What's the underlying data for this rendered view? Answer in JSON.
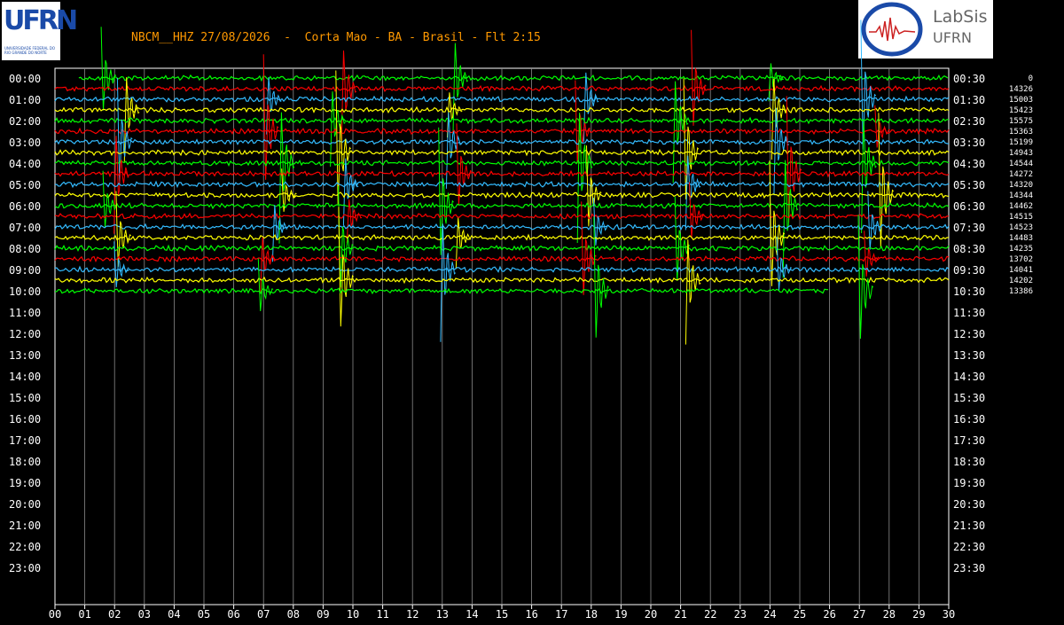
{
  "header": {
    "title": "NBCM__HHZ 27/08/2026  -  Corta Mao - BA - Brasil - Flt 2:15",
    "logo_left_text": "UFRN",
    "logo_left_tagline": "UNIVERSIDADE FEDERAL DO RIO GRANDE DO NORTE",
    "logo_right_line1": "LabSis",
    "logo_right_line2": "UFRN"
  },
  "chart_data": {
    "type": "line",
    "title": "NBCM__HHZ 27/08/2026  -  Corta Mao - BA - Brasil - Flt 2:15",
    "xlabel": "",
    "ylabel": "",
    "x_ticks": [
      "00",
      "01",
      "02",
      "03",
      "04",
      "05",
      "06",
      "07",
      "08",
      "09",
      "10",
      "11",
      "12",
      "13",
      "14",
      "15",
      "16",
      "17",
      "18",
      "19",
      "20",
      "21",
      "22",
      "23",
      "24",
      "25",
      "26",
      "27",
      "28",
      "29",
      "30"
    ],
    "x_range_minutes": [
      0,
      30
    ],
    "hour_labels_left": [
      "00:00",
      "01:00",
      "02:00",
      "03:00",
      "04:00",
      "05:00",
      "06:00",
      "07:00",
      "08:00",
      "09:00",
      "10:00",
      "11:00",
      "12:00",
      "13:00",
      "14:00",
      "15:00",
      "16:00",
      "17:00",
      "18:00",
      "19:00",
      "20:00",
      "21:00",
      "22:00",
      "23:00"
    ],
    "hour_labels_right": [
      "00:30",
      "01:30",
      "02:30",
      "03:30",
      "04:30",
      "05:30",
      "06:30",
      "07:30",
      "08:30",
      "09:30",
      "10:30",
      "11:30",
      "12:30",
      "13:30",
      "14:30",
      "15:30",
      "16:30",
      "17:30",
      "18:30",
      "19:30",
      "20:30",
      "21:30",
      "22:30",
      "23:30"
    ],
    "trace_amplitudes": [
      "0",
      "14326",
      "15003",
      "15423",
      "15575",
      "15363",
      "15199",
      "14943",
      "14544",
      "14272",
      "14320",
      "14344",
      "14462",
      "14515",
      "14523",
      "14483",
      "14235",
      "13702",
      "14041",
      "14202",
      "13386"
    ],
    "trace_colors": [
      "#00ff00",
      "#ff0000",
      "#33bbff",
      "#ffff00"
    ],
    "traces": [
      {
        "color_index": 0,
        "start_min": 0.8,
        "end_min": 30
      },
      {
        "color_index": 1,
        "start_min": 0,
        "end_min": 30
      },
      {
        "color_index": 2,
        "start_min": 0,
        "end_min": 30
      },
      {
        "color_index": 3,
        "start_min": 0,
        "end_min": 30
      },
      {
        "color_index": 0,
        "start_min": 0,
        "end_min": 30
      },
      {
        "color_index": 1,
        "start_min": 0,
        "end_min": 30
      },
      {
        "color_index": 2,
        "start_min": 0,
        "end_min": 30
      },
      {
        "color_index": 3,
        "start_min": 0,
        "end_min": 30
      },
      {
        "color_index": 0,
        "start_min": 0,
        "end_min": 30
      },
      {
        "color_index": 1,
        "start_min": 0,
        "end_min": 30
      },
      {
        "color_index": 2,
        "start_min": 0,
        "end_min": 30
      },
      {
        "color_index": 3,
        "start_min": 0,
        "end_min": 30
      },
      {
        "color_index": 0,
        "start_min": 0,
        "end_min": 30
      },
      {
        "color_index": 1,
        "start_min": 0,
        "end_min": 30
      },
      {
        "color_index": 2,
        "start_min": 0,
        "end_min": 30
      },
      {
        "color_index": 3,
        "start_min": 0,
        "end_min": 30
      },
      {
        "color_index": 0,
        "start_min": 0,
        "end_min": 30
      },
      {
        "color_index": 1,
        "start_min": 0,
        "end_min": 30
      },
      {
        "color_index": 2,
        "start_min": 0,
        "end_min": 30
      },
      {
        "color_index": 3,
        "start_min": 0,
        "end_min": 30
      },
      {
        "color_index": 0,
        "start_min": 0,
        "end_min": 26
      }
    ],
    "events_minutes": [
      1.9,
      7.2,
      9.6,
      13.3,
      17.8,
      21.1,
      24.4,
      27.4
    ],
    "grid": true,
    "legend": "none"
  }
}
